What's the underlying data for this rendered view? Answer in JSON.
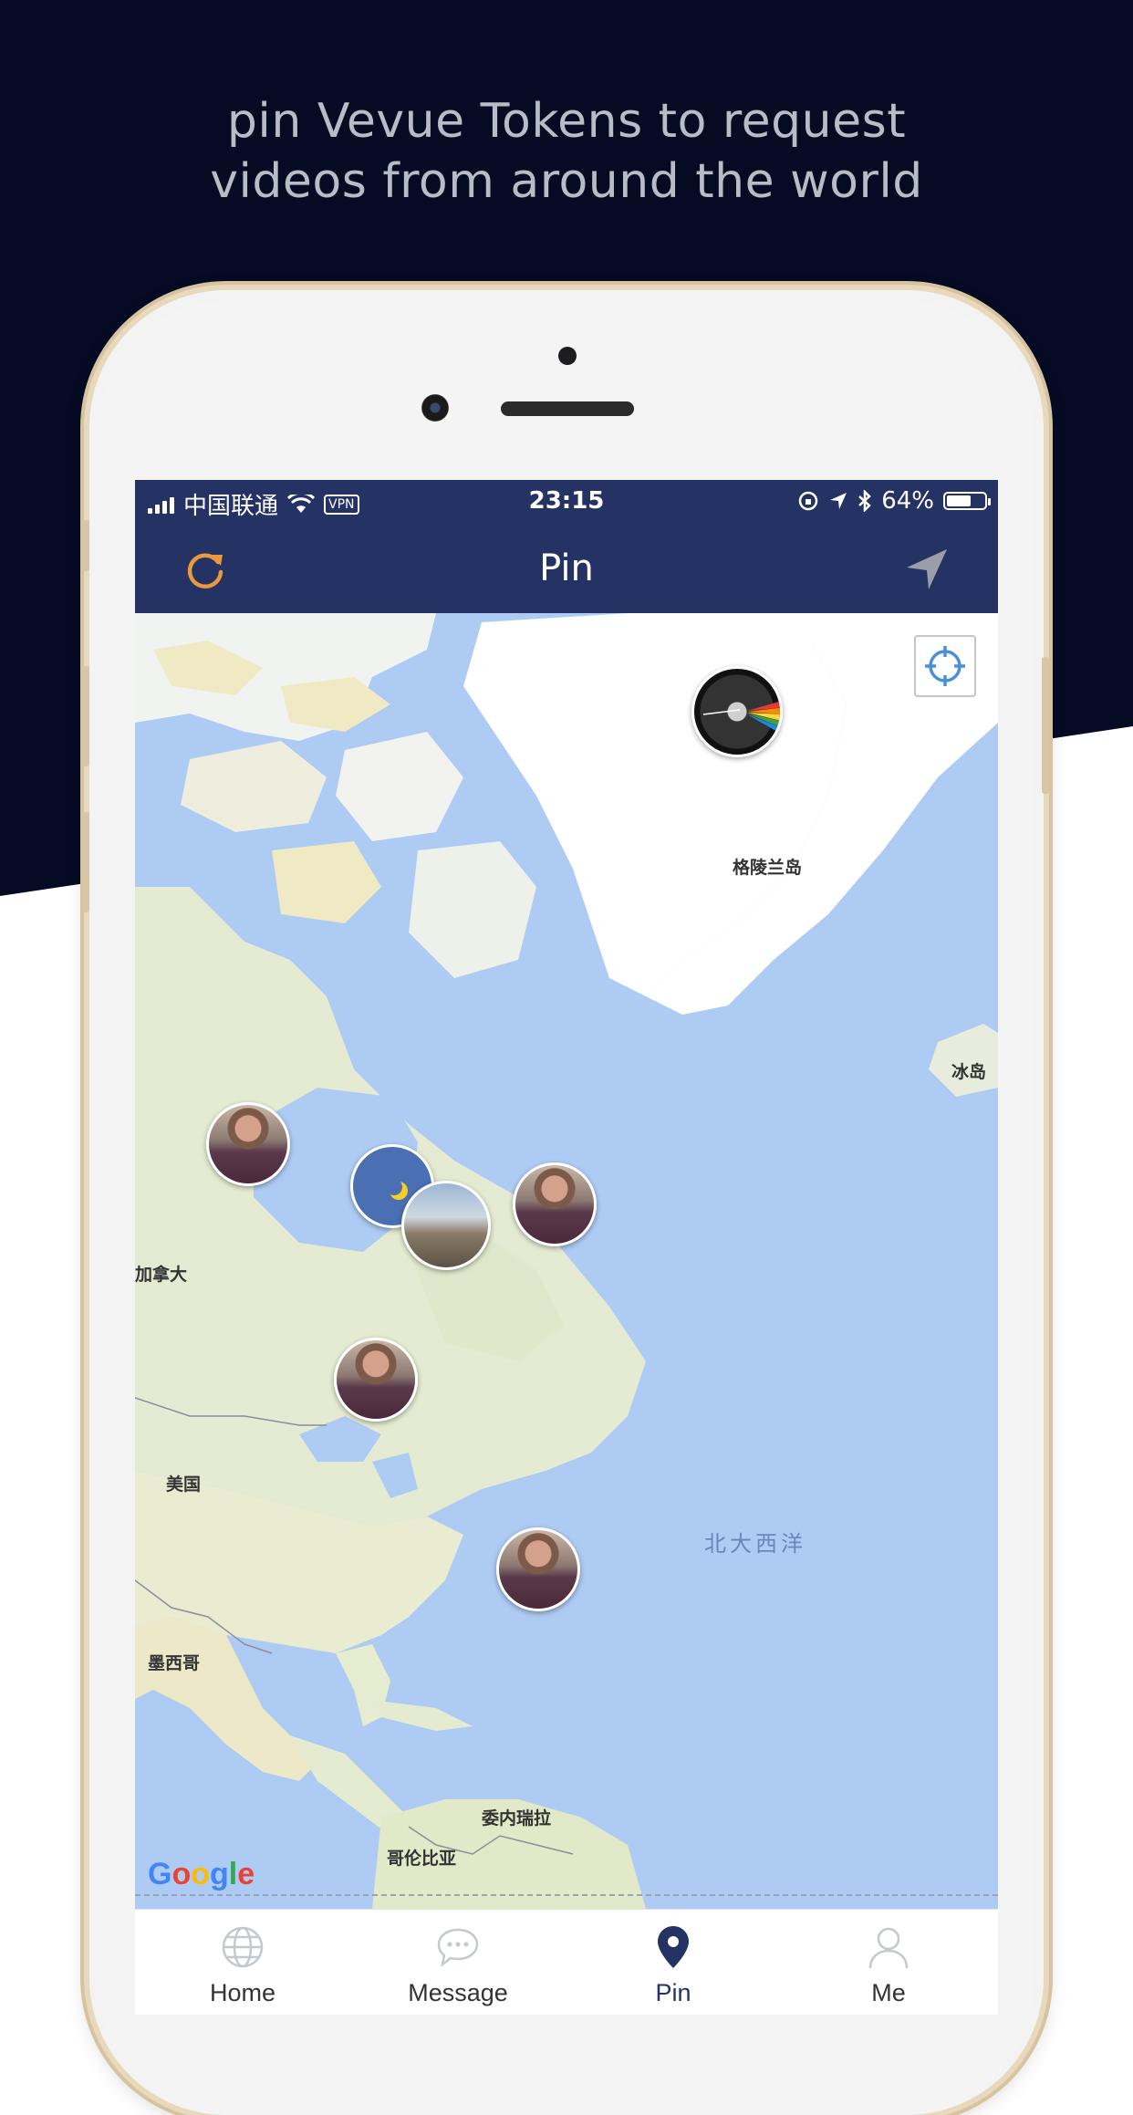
{
  "headline": {
    "line1": "pin Vevue Tokens to request",
    "line2": "videos from around the world"
  },
  "status_bar": {
    "carrier": "中国联通",
    "vpn": "VPN",
    "time": "23:15",
    "battery": "64%",
    "battery_level": 0.64
  },
  "nav": {
    "title": "Pin",
    "refresh_icon": "refresh-icon",
    "locate_icon": "navigation-arrow-icon"
  },
  "map": {
    "labels": {
      "greenland": "格陵兰岛",
      "iceland": "冰岛",
      "canada": "加拿大",
      "usa": "美国",
      "mexico": "墨西哥",
      "venezuela": "委内瑞拉",
      "colombia": "哥伦比亚",
      "atlantic": "北大西洋"
    },
    "attribution": [
      "G",
      "o",
      "o",
      "g",
      "l",
      "e"
    ],
    "center_icon": "crosshair-icon"
  },
  "tabs": [
    {
      "label": "Home",
      "icon": "globe-icon"
    },
    {
      "label": "Message",
      "icon": "chat-bubble-icon"
    },
    {
      "label": "Pin",
      "icon": "map-pin-icon",
      "active": true
    },
    {
      "label": "Me",
      "icon": "person-icon"
    }
  ],
  "colors": {
    "navy": "#253264",
    "dark_bg": "#050b22",
    "accent_orange": "#e89a3c",
    "water": "#aecbf4",
    "land": "#e7ecd8"
  }
}
